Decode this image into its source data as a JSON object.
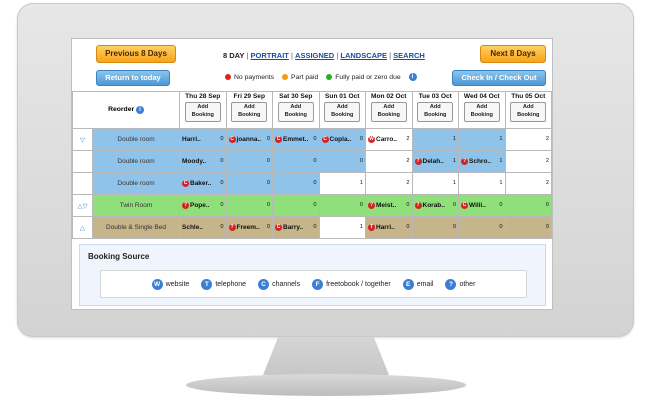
{
  "header": {
    "prev_label": "Previous 8 Days",
    "next_label": "Next 8 Days",
    "return_label": "Return to today",
    "checkin_label": "Check In / Check Out",
    "views": [
      "8 DAY",
      "PORTRAIT",
      "ASSIGNED",
      "LANDSCAPE",
      "SEARCH"
    ],
    "sep": "|"
  },
  "legend": {
    "no_payments": "No payments",
    "part_paid": "Part paid",
    "fully_paid": "Fully paid or zero due",
    "info_glyph": "i"
  },
  "colors": {
    "no_payments": "#e21f1f",
    "part_paid": "#f39c12",
    "fully_paid": "#27b024",
    "booked_blue": "#8fc3e9",
    "twin_green": "#8fe07a",
    "double_single_tan": "#c6b58a"
  },
  "grid": {
    "reorder_label": "Reorder",
    "days": [
      "Thu 28 Sep",
      "Fri 29 Sep",
      "Sat 30 Sep",
      "Sun 01 Oct",
      "Mon 02 Oct",
      "Tue 03 Oct",
      "Wed 04 Oct",
      "Thu 05 Oct"
    ],
    "add_line1": "Add",
    "add_line2": "Booking",
    "rows": [
      {
        "room": "Double room",
        "arrows": "▽",
        "cells": [
          {
            "name": "Harri..",
            "icon": "",
            "count": "0"
          },
          {
            "name": "joanna..",
            "icon": "C",
            "count": "0"
          },
          {
            "name": "Emmet..",
            "icon": "C",
            "count": "0"
          },
          {
            "name": "Copla..",
            "icon": "C",
            "count": "0"
          },
          {
            "name": "Carro..",
            "icon": "W",
            "count": "2"
          },
          {
            "name": "",
            "icon": "",
            "count": "1"
          },
          {
            "name": "",
            "icon": "",
            "count": "1"
          },
          {
            "name": "",
            "icon": "",
            "count": "2"
          }
        ]
      },
      {
        "room": "Double room",
        "arrows": "",
        "cells": [
          {
            "name": "Moody..",
            "icon": "",
            "count": "0"
          },
          {
            "name": "",
            "icon": "",
            "count": "0"
          },
          {
            "name": "",
            "icon": "",
            "count": "0"
          },
          {
            "name": "",
            "icon": "",
            "count": "0"
          },
          {
            "name": "",
            "icon": "",
            "count": "2"
          },
          {
            "name": "Delah..",
            "icon": "?",
            "count": "1"
          },
          {
            "name": "Schro..",
            "icon": "?",
            "count": "1"
          },
          {
            "name": "",
            "icon": "",
            "count": "2"
          }
        ]
      },
      {
        "room": "Double room",
        "arrows": "",
        "cells": [
          {
            "name": "Baker..",
            "icon": "C",
            "count": "0"
          },
          {
            "name": "",
            "icon": "",
            "count": "0"
          },
          {
            "name": "",
            "icon": "",
            "count": "0"
          },
          {
            "name": "",
            "icon": "",
            "count": "1"
          },
          {
            "name": "",
            "icon": "",
            "count": "2"
          },
          {
            "name": "",
            "icon": "",
            "count": "1"
          },
          {
            "name": "",
            "icon": "",
            "count": "1"
          },
          {
            "name": "",
            "icon": "",
            "count": "2"
          }
        ]
      },
      {
        "room": "Twin Room",
        "arrows": "△▽",
        "cells": [
          {
            "name": "Pope..",
            "icon": "?",
            "count": "0"
          },
          {
            "name": "",
            "icon": "",
            "count": "0"
          },
          {
            "name": "",
            "icon": "",
            "count": "0"
          },
          {
            "name": "",
            "icon": "",
            "count": "0"
          },
          {
            "name": "Meist..",
            "icon": "?",
            "count": "0"
          },
          {
            "name": "Korab..",
            "icon": "?",
            "count": "0"
          },
          {
            "name": "Willi..",
            "icon": "C",
            "count": "0"
          },
          {
            "name": "",
            "icon": "",
            "count": "0"
          }
        ]
      },
      {
        "room": "Double & Single Bed",
        "arrows": "△",
        "cells": [
          {
            "name": "Schle..",
            "icon": "",
            "count": "0"
          },
          {
            "name": "Freem..",
            "icon": "?",
            "count": "0"
          },
          {
            "name": "Barry..",
            "icon": "C",
            "count": "0"
          },
          {
            "name": "",
            "icon": "",
            "count": "1"
          },
          {
            "name": "Harri..",
            "icon": "T",
            "count": "0"
          },
          {
            "name": "",
            "icon": "",
            "count": "0"
          },
          {
            "name": "",
            "icon": "",
            "count": "0"
          },
          {
            "name": "",
            "icon": "",
            "count": "0"
          }
        ]
      }
    ]
  },
  "booking_source": {
    "title": "Booking Source",
    "items": [
      {
        "icon": "W",
        "label": "website"
      },
      {
        "icon": "T",
        "label": "telephone"
      },
      {
        "icon": "C",
        "label": "channels"
      },
      {
        "icon": "F",
        "label": "freetobook / together"
      },
      {
        "icon": "E",
        "label": "email"
      },
      {
        "icon": "?",
        "label": "other"
      }
    ]
  }
}
